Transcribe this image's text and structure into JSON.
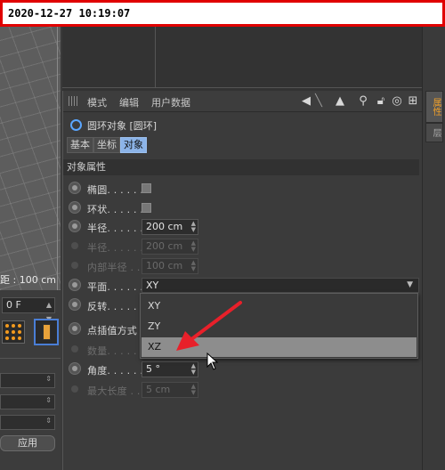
{
  "timestamp": "2020-12-27  10:19:07",
  "viewport": {
    "distance_label": "距 : 100 cm"
  },
  "timeline": {
    "frame_value": "0 F",
    "apply_label": "应用"
  },
  "menu": {
    "items": [
      "模式",
      "编辑",
      "用户数据"
    ]
  },
  "object": {
    "title": "圆环对象 [圆环]",
    "tabs": [
      "基本",
      "坐标",
      "对象"
    ],
    "active_tab": "对象"
  },
  "section": {
    "header": "对象属性"
  },
  "properties": {
    "ellipse": {
      "label": "椭圆. . . . . . "
    },
    "ring": {
      "label": "环状. . . . . . "
    },
    "radius": {
      "label": "半径. . . . . . ",
      "value": "200 cm"
    },
    "radius2": {
      "label": "半径. . . . . . ",
      "value": "200 cm"
    },
    "inner_radius": {
      "label": "内部半径 . . ",
      "value": "100 cm"
    },
    "plane": {
      "label": "平面. . . . . . ",
      "value": "XY"
    },
    "reverse": {
      "label": "反转. . . . . . "
    },
    "interp": {
      "label": "点插值方式"
    },
    "count": {
      "label": "数量. . . . . . "
    },
    "angle": {
      "label": "角度. . . . . . ",
      "value": "5 °"
    },
    "max_length": {
      "label": "最大长度 . . ",
      "value": "5 cm"
    }
  },
  "plane_dropdown": {
    "options": [
      "XY",
      "ZY",
      "XZ"
    ],
    "highlighted": "XZ"
  },
  "right_tabs": [
    "属性",
    "层"
  ],
  "colors": {
    "annotation_arrow": "#e8202a",
    "active_tab": "#8cb4e8",
    "highlight_border": "#e00000"
  }
}
